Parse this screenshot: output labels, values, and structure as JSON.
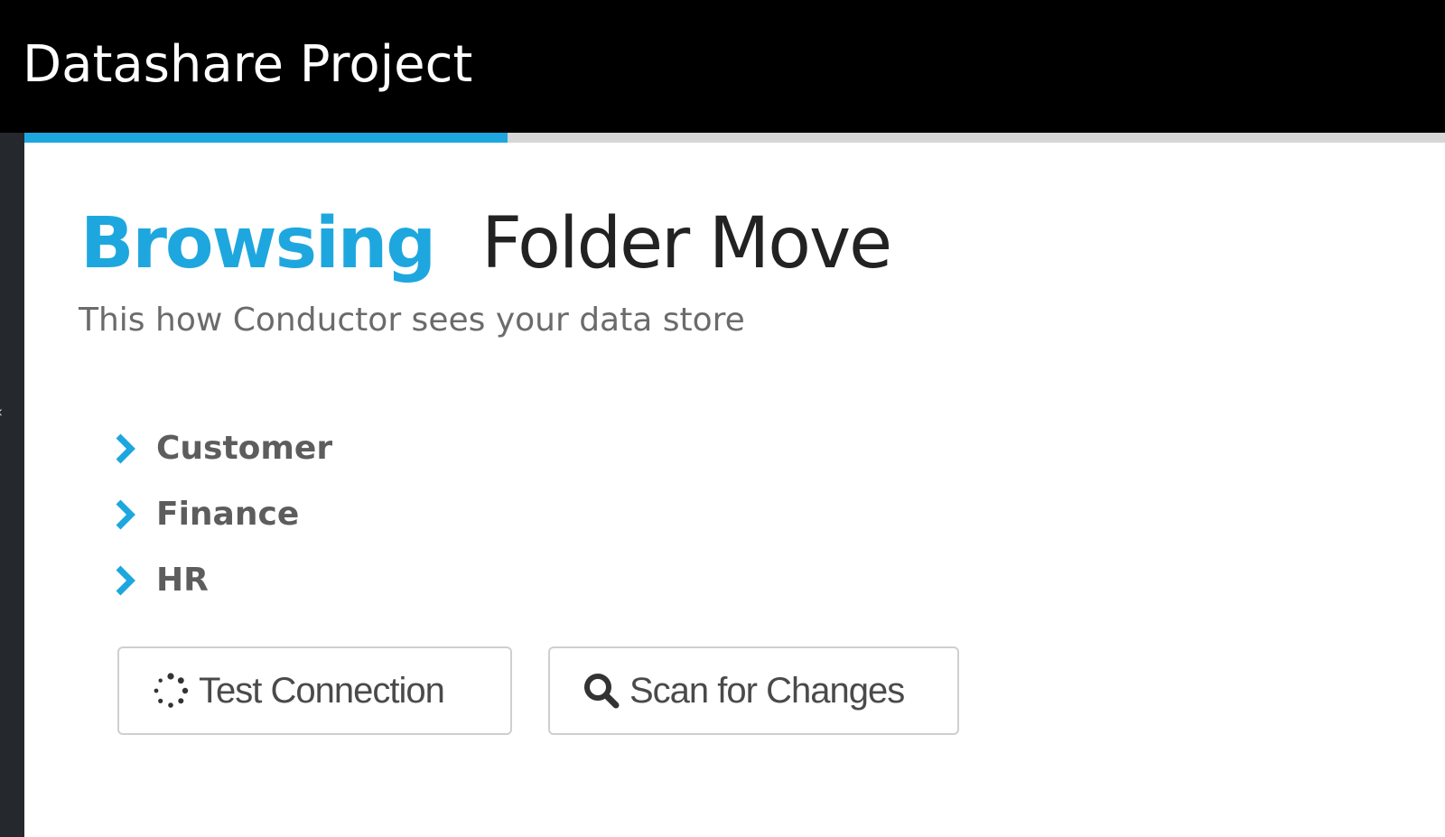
{
  "window": {
    "title": "Datashare Project"
  },
  "progress": {
    "fraction": 0.34,
    "accent_color": "#1ea7df"
  },
  "header": {
    "mode_label": "Browsing",
    "target_name": "Folder Move",
    "subtitle": "This how Conductor sees your data store"
  },
  "tree": {
    "items": [
      {
        "label": "Customer",
        "icon": "chevron-right-icon"
      },
      {
        "label": "Finance",
        "icon": "chevron-right-icon"
      },
      {
        "label": "HR",
        "icon": "chevron-right-icon"
      }
    ]
  },
  "actions": {
    "test_connection": {
      "label": "Test Connection",
      "icon": "spinner-icon"
    },
    "scan_changes": {
      "label": "Scan for Changes",
      "icon": "search-icon"
    }
  },
  "colors": {
    "accent": "#1ea7df",
    "titlebar": "#000000"
  }
}
